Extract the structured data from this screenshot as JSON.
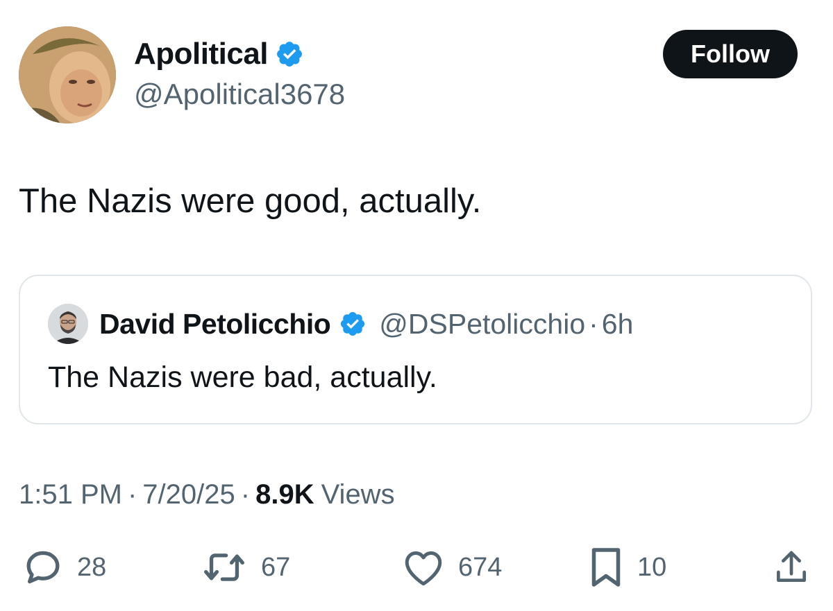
{
  "author": {
    "display_name": "Apolitical",
    "handle": "@Apolitical3678",
    "verified": true
  },
  "follow_button": {
    "label": "Follow"
  },
  "tweet": {
    "text": "The Nazis were good, actually."
  },
  "quoted_tweet": {
    "display_name": "David Petolicchio",
    "handle": "@DSPetolicchio",
    "separator": "·",
    "time": "6h",
    "verified": true,
    "text": "The Nazis were bad, actually."
  },
  "meta": {
    "time": "1:51 PM",
    "separator": "·",
    "date": "7/20/25",
    "views_count": "8.9K",
    "views_label": "Views"
  },
  "actions": {
    "replies": "28",
    "reposts": "67",
    "likes": "674",
    "bookmarks": "10"
  },
  "colors": {
    "text_primary": "#0f1419",
    "text_secondary": "#536471",
    "verified_blue": "#1d9bf0",
    "button_bg": "#0f1419",
    "border": "#e1e6ea"
  },
  "icons": {
    "verified": "verified-badge-icon",
    "reply": "comment-bubble-icon",
    "repost": "repost-arrows-icon",
    "like": "heart-icon",
    "bookmark": "bookmark-icon",
    "share": "share-upload-icon"
  }
}
